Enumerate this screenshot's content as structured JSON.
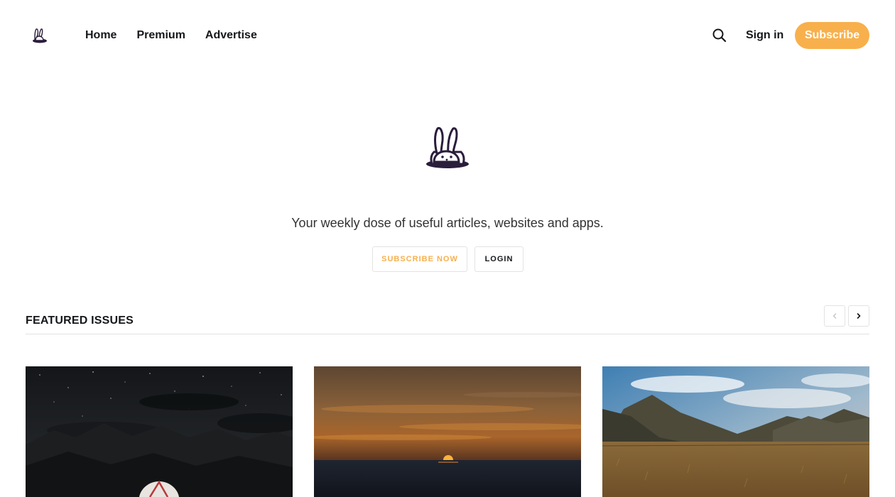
{
  "header": {
    "logo_icon": "bunny-in-hat-icon",
    "nav": [
      {
        "label": "Home"
      },
      {
        "label": "Premium"
      },
      {
        "label": "Advertise"
      }
    ],
    "search_icon": "search-icon",
    "signin_label": "Sign in",
    "subscribe_label": "Subscribe"
  },
  "hero": {
    "logo_icon": "bunny-in-hat-icon",
    "tagline": "Your weekly dose of useful articles, websites and apps.",
    "subscribe_now_label": "SUBSCRIBE NOW",
    "login_label": "LOGIN"
  },
  "featured": {
    "title": "FEATURED ISSUES",
    "prev_icon": "chevron-left-icon",
    "next_icon": "chevron-right-icon",
    "cards": [
      {
        "image": "night-sky-mountains-tent-photo"
      },
      {
        "image": "ocean-sunset-photo"
      },
      {
        "image": "mountain-valley-field-photo"
      }
    ]
  },
  "colors": {
    "accent": "#f8b04c",
    "text": "#15171a",
    "border": "#e3e3e3",
    "logo": "#2b1d3c"
  }
}
